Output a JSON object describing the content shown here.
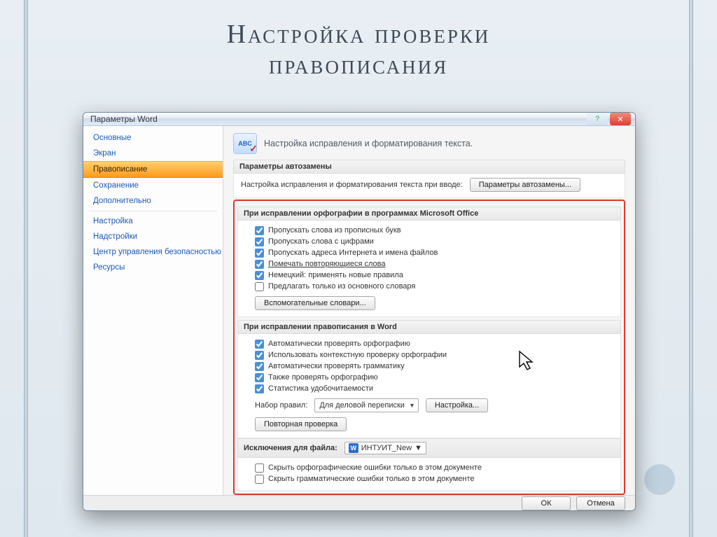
{
  "slide": {
    "title": "Настройка проверки\nправописания"
  },
  "dialog": {
    "title": "Параметры Word"
  },
  "sidebar": {
    "items": [
      "Основные",
      "Экран",
      "Правописание",
      "Сохранение",
      "Дополнительно",
      "Настройка",
      "Надстройки",
      "Центр управления безопасностью",
      "Ресурсы"
    ],
    "selected_index": 2
  },
  "main": {
    "header": "Настройка исправления и форматирования текста.",
    "autocorrect": {
      "title": "Параметры автозамены",
      "desc": "Настройка исправления и форматирования текста при вводе:",
      "button": "Параметры автозамены..."
    },
    "office": {
      "title": "При исправлении орфографии в программах Microsoft Office",
      "items": [
        "Пропускать слова из прописных букв",
        "Пропускать слова с цифрами",
        "Пропускать адреса Интернета и имена файлов",
        "Помечать повторяющиеся слова",
        "Немецкий: применять новые правила",
        "Предлагать только из основного словаря"
      ],
      "checked": [
        true,
        true,
        true,
        true,
        true,
        false
      ],
      "button": "Вспомогательные словари..."
    },
    "word": {
      "title": "При исправлении правописания в Word",
      "items": [
        "Автоматически проверять орфографию",
        "Использовать контекстную проверку орфографии",
        "Автоматически проверять грамматику",
        "Также проверять орфографию",
        "Статистика удобочитаемости"
      ],
      "checked": [
        true,
        true,
        true,
        true,
        true
      ],
      "ruleset_label": "Набор правил:",
      "ruleset_value": "Для деловой переписки",
      "settings_button": "Настройка...",
      "recheck_button": "Повторная проверка"
    },
    "exclusions": {
      "label": "Исключения для файла:",
      "file": "ИНТУИТ_New",
      "items": [
        "Скрыть орфографические ошибки только в этом документе",
        "Скрыть грамматические ошибки только в этом документе"
      ],
      "checked": [
        false,
        false
      ]
    }
  },
  "footer": {
    "ok": "ОК",
    "cancel": "Отмена"
  }
}
